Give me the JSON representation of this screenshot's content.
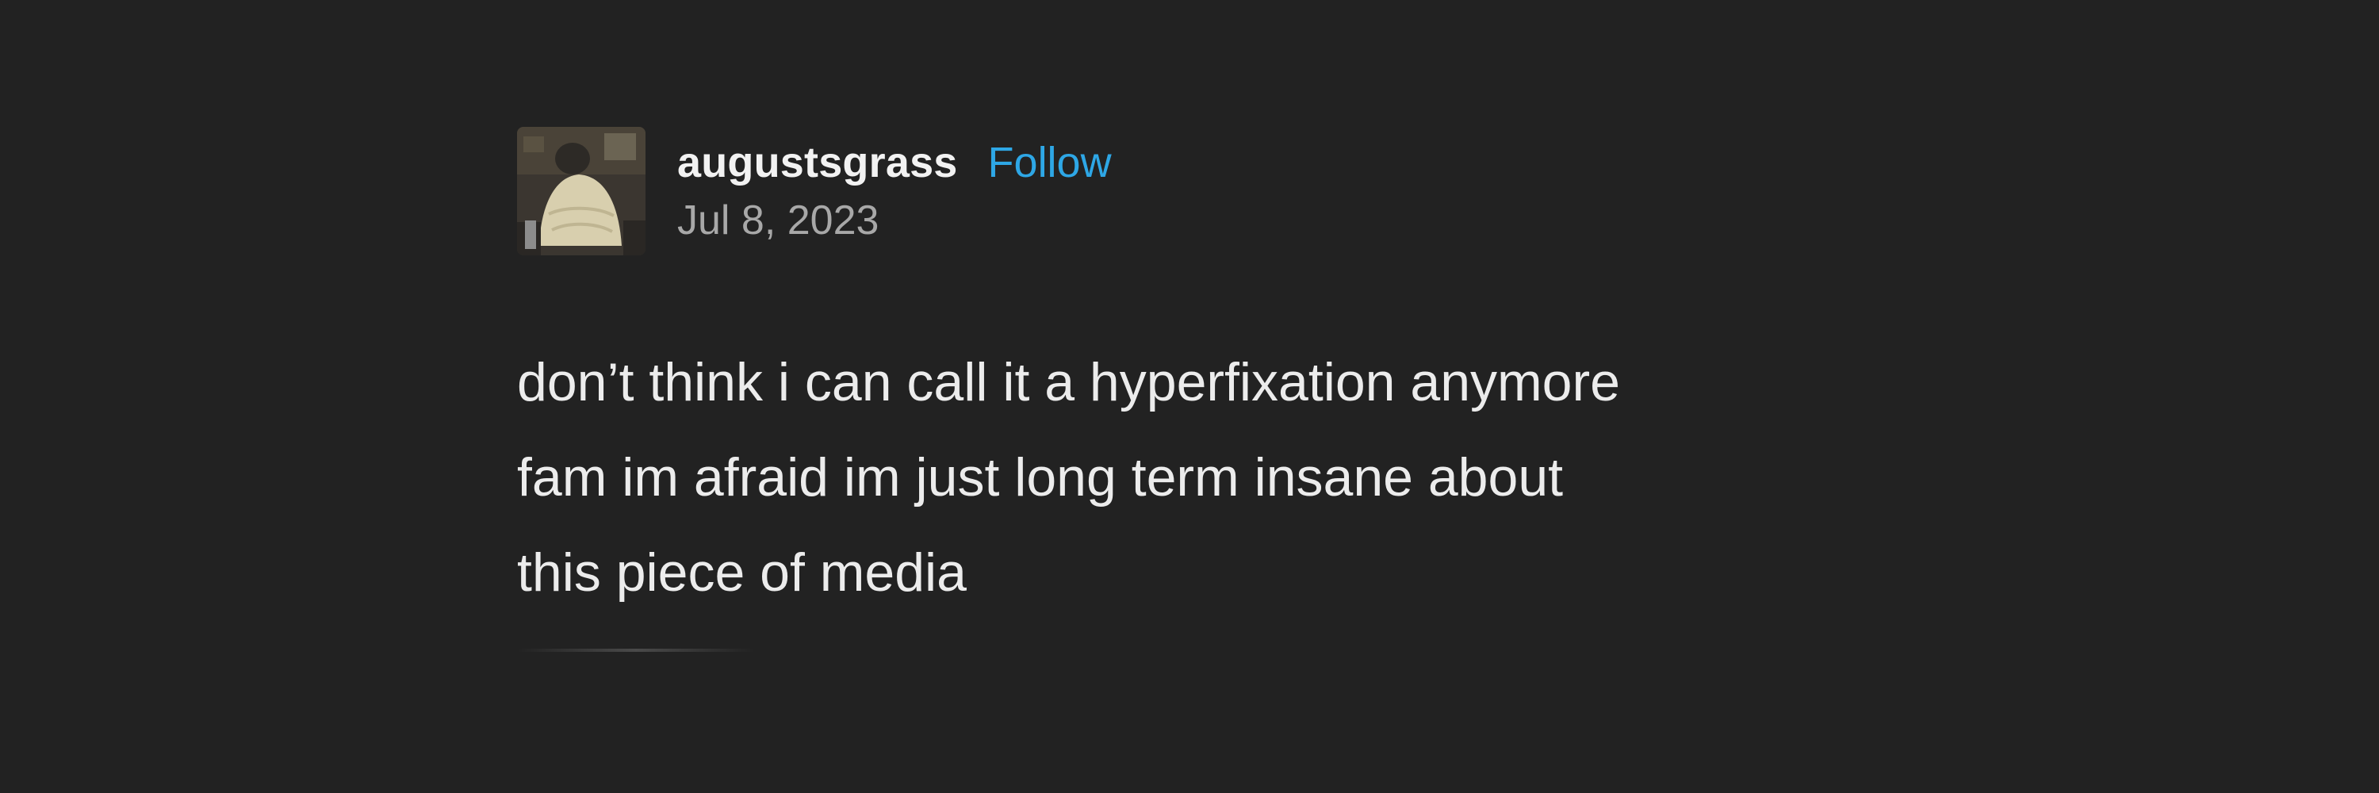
{
  "post": {
    "author": {
      "username": "augustsgrass",
      "follow_label": "Follow",
      "avatar_icon": "user-avatar-photo"
    },
    "date": "Jul 8, 2023",
    "body_lines": [
      "don’t think i can call it a hyperfixation anymore",
      "fam im afraid im just long term insane about",
      "this piece of media"
    ]
  },
  "colors": {
    "background": "#222222",
    "text": "#ececec",
    "follow": "#2ea7e6",
    "date": "#a8a8a8"
  }
}
